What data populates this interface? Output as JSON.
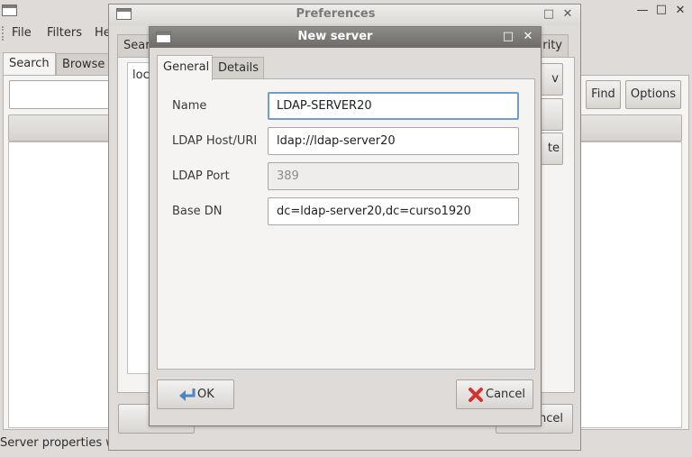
{
  "main_window": {
    "menu": [
      "File",
      "Filters",
      "He"
    ],
    "tabs": [
      "Search",
      "Browse"
    ],
    "buttons": {
      "find": "Find",
      "options": "Options"
    },
    "status": "Server properties wi",
    "controls": {
      "minimize": "—",
      "maximize": "□",
      "close": "✕"
    }
  },
  "preferences": {
    "title": "Preferences",
    "tab_left": "Sear",
    "tab_right": "rity",
    "list_item": "loc",
    "side_buttons": [
      "v",
      "",
      "te"
    ],
    "bottom_right_label": "ncel",
    "controls": {
      "maximize": "□",
      "close": "✕"
    }
  },
  "dialog": {
    "title": "New server",
    "controls": {
      "maximize": "□",
      "close": "✕"
    },
    "tabs": [
      "General",
      "Details"
    ],
    "fields": {
      "name": {
        "label": "Name",
        "value": "LDAP-SERVER20"
      },
      "host": {
        "label": "LDAP Host/URI",
        "value": "ldap://ldap-server20"
      },
      "port": {
        "label": "LDAP Port",
        "value": "389"
      },
      "base_dn": {
        "label": "Base DN",
        "value": "dc=ldap-server20,dc=curso1920"
      }
    },
    "ok_label": "OK",
    "cancel_label": "Cancel",
    "colors": {
      "focus": "#6f9ec9",
      "cancel_icon": "#d0342c",
      "ok_icon": "#4a86c5"
    }
  }
}
